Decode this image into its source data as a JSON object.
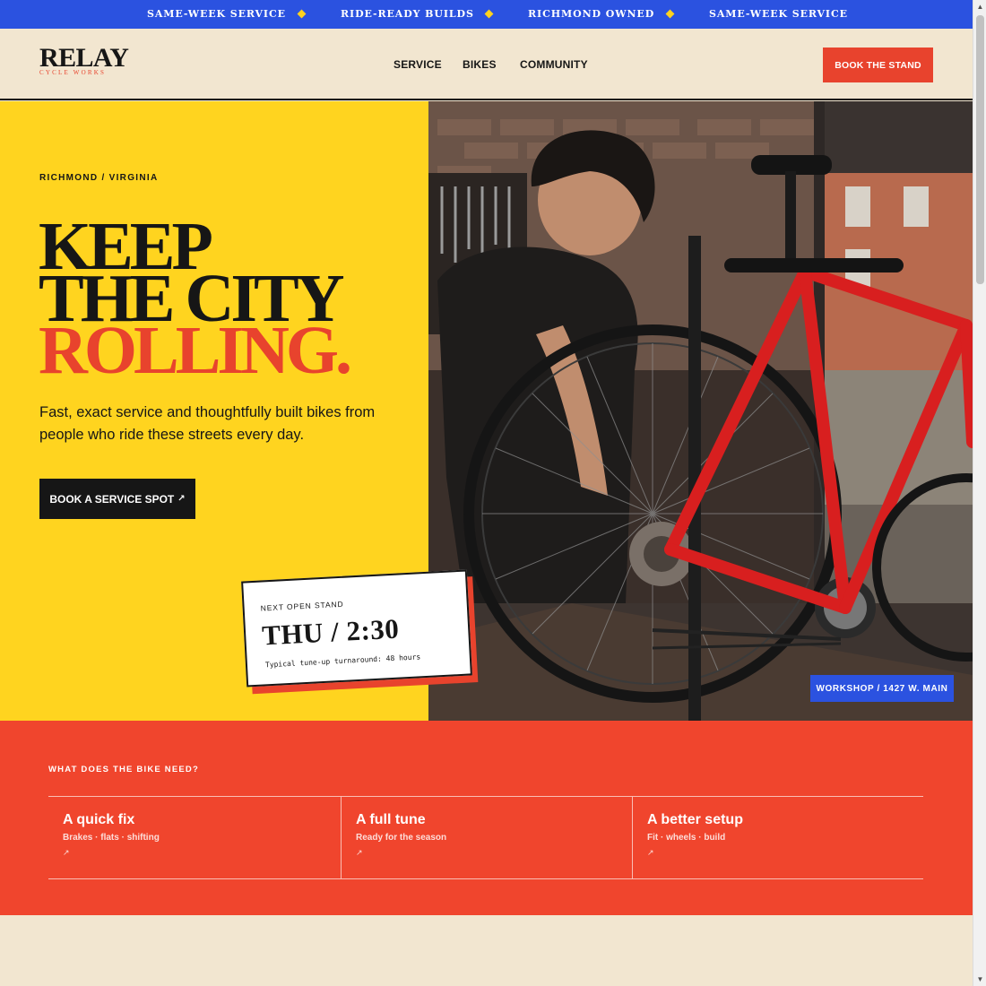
{
  "ticker": {
    "items": [
      "SAME-WEEK SERVICE",
      "RIDE-READY BUILDS",
      "RICHMOND OWNED",
      "SAME-WEEK SERVICE"
    ]
  },
  "brand": {
    "name": "RELAY",
    "tagline": "CYCLE WORKS"
  },
  "nav": {
    "links": [
      "SERVICE",
      "BIKES",
      "COMMUNITY"
    ],
    "cta_label": "BOOK THE STAND"
  },
  "hero": {
    "eyebrow": "RICHMOND / VIRGINIA",
    "headline": [
      "KEEP",
      "THE CITY",
      "ROLLING."
    ],
    "lede": "Fast, exact service and thoughtfully built bikes from people who ride these streets every day.",
    "cta_label": "BOOK A SERVICE SPOT",
    "cta_arrow": "↗",
    "photo_alt": "Mechanic tuning a red road bike on a workshop stand",
    "location_badge": "WORKSHOP / 1427 W. MAIN"
  },
  "stand_card": {
    "label": "NEXT OPEN STAND",
    "time": "THU / 2:30",
    "note": "Typical tune-up turnaround: 48 hours"
  },
  "needs": {
    "title": "WHAT DOES THE BIKE NEED?",
    "items": [
      {
        "title": "A quick fix",
        "subtitle": "Brakes · flats · shifting",
        "arrow": "↗"
      },
      {
        "title": "A full tune",
        "subtitle": "Ready for the season",
        "arrow": "↗"
      },
      {
        "title": "A better setup",
        "subtitle": "Fit · wheels · build",
        "arrow": "↗"
      }
    ]
  },
  "colors": {
    "blue": "#2b52e0",
    "yellow": "#ffd41f",
    "red": "#f0452d",
    "cream": "#f2e6d0",
    "ink": "#161616"
  }
}
